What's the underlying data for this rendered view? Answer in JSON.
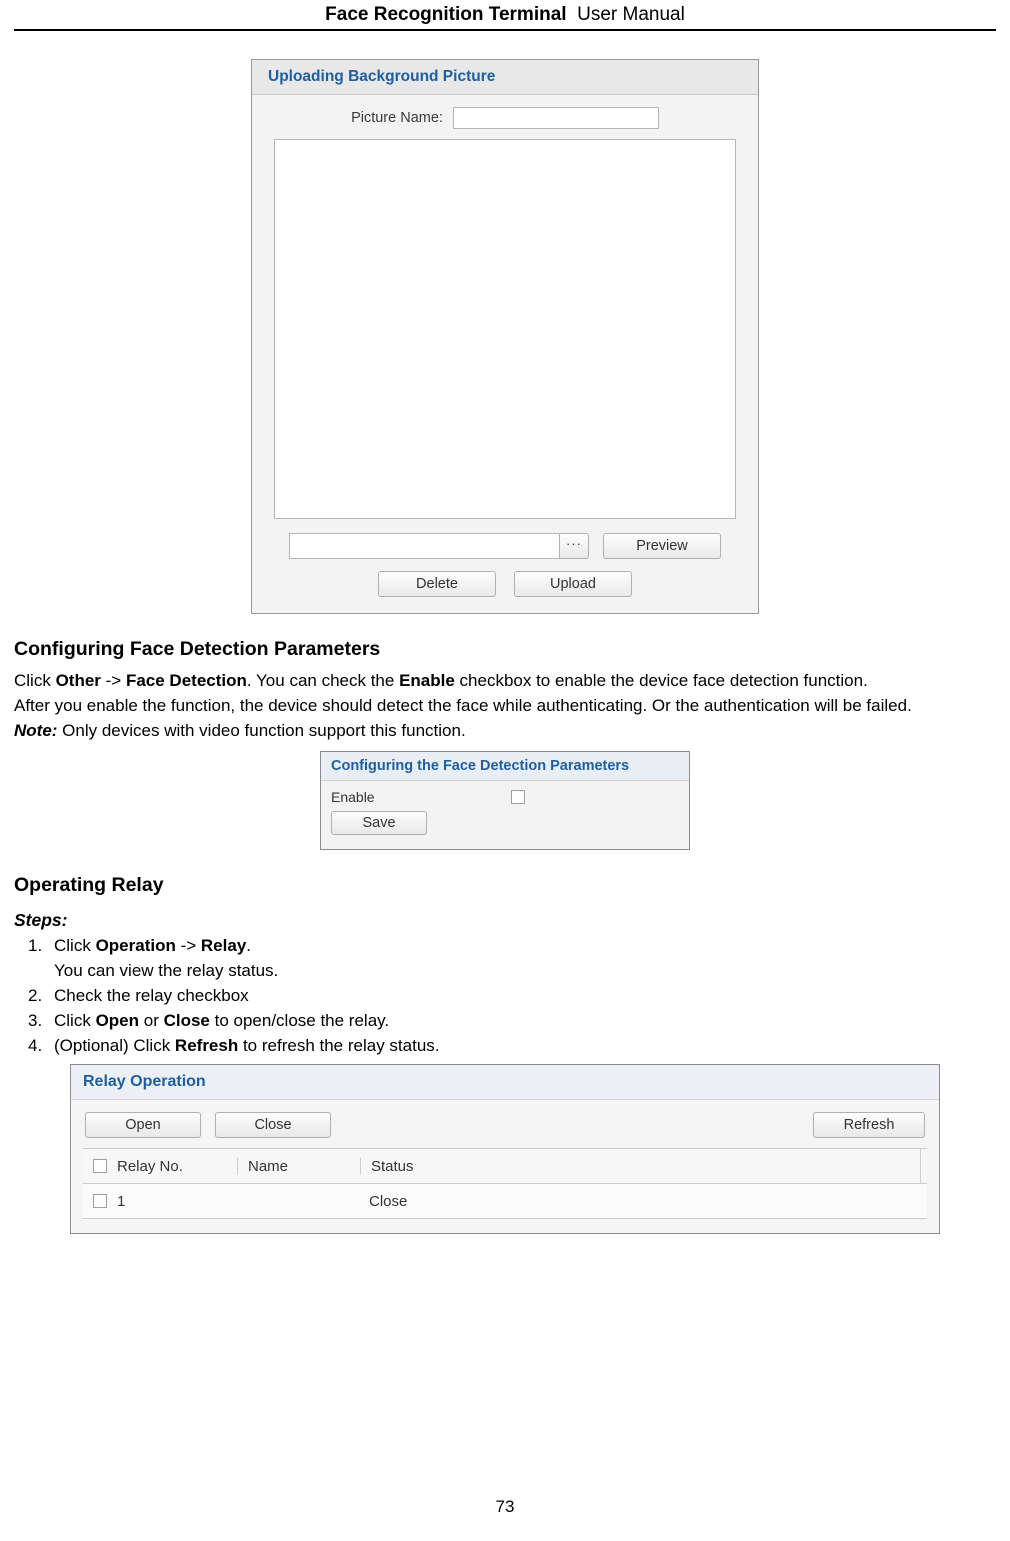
{
  "header": {
    "title_bold": "Face Recognition Terminal",
    "title_normal": "User Manual"
  },
  "figure_upload": {
    "title": "Uploading Background Picture",
    "picture_name_label": "Picture Name:",
    "picture_name_value": "",
    "path_value": "",
    "browse_label": "···",
    "preview_label": "Preview",
    "delete_label": "Delete",
    "upload_label": "Upload"
  },
  "section_face_detection": {
    "heading": "Configuring Face Detection Parameters",
    "para1_pre": "Click ",
    "para1_b1": "Other",
    "para1_mid1": " -> ",
    "para1_b2": "Face Detection",
    "para1_mid2": ". You can check the ",
    "para1_b3": "Enable",
    "para1_post": " checkbox to enable the device face detection function.",
    "para2": "After you enable the function, the device should detect the face while authenticating. Or the authentication will be failed.",
    "note_label": "Note:",
    "note_text": " Only devices with video function support this function."
  },
  "figure_face_detection": {
    "title": "Configuring the Face Detection Parameters",
    "enable_label": "Enable",
    "enable_checked": false,
    "save_label": "Save"
  },
  "section_relay": {
    "heading": "Operating Relay",
    "steps_label": "Steps:",
    "steps": [
      {
        "num": "1.",
        "parts": [
          {
            "t": "Click ",
            "b": false
          },
          {
            "t": "Operation",
            "b": true
          },
          {
            "t": " -> ",
            "b": false
          },
          {
            "t": "Relay",
            "b": true
          },
          {
            "t": ".",
            "b": false
          }
        ],
        "sub": "You can view the relay status."
      },
      {
        "num": "2.",
        "parts": [
          {
            "t": "Check the relay checkbox",
            "b": false
          }
        ],
        "sub": ""
      },
      {
        "num": "3.",
        "parts": [
          {
            "t": "Click ",
            "b": false
          },
          {
            "t": "Open",
            "b": true
          },
          {
            "t": " or ",
            "b": false
          },
          {
            "t": "Close",
            "b": true
          },
          {
            "t": " to open/close the relay.",
            "b": false
          }
        ],
        "sub": ""
      },
      {
        "num": "4.",
        "parts": [
          {
            "t": "(Optional) Click ",
            "b": false
          },
          {
            "t": "Refresh",
            "b": true
          },
          {
            "t": " to refresh the relay status.",
            "b": false
          }
        ],
        "sub": ""
      }
    ]
  },
  "figure_relay": {
    "title": "Relay Operation",
    "open_label": "Open",
    "close_label": "Close",
    "refresh_label": "Refresh",
    "columns": [
      "Relay No.",
      "Name",
      "Status"
    ],
    "rows": [
      {
        "no": "1",
        "name": "",
        "status": "Close"
      }
    ]
  },
  "footer": {
    "page_number": "73"
  }
}
